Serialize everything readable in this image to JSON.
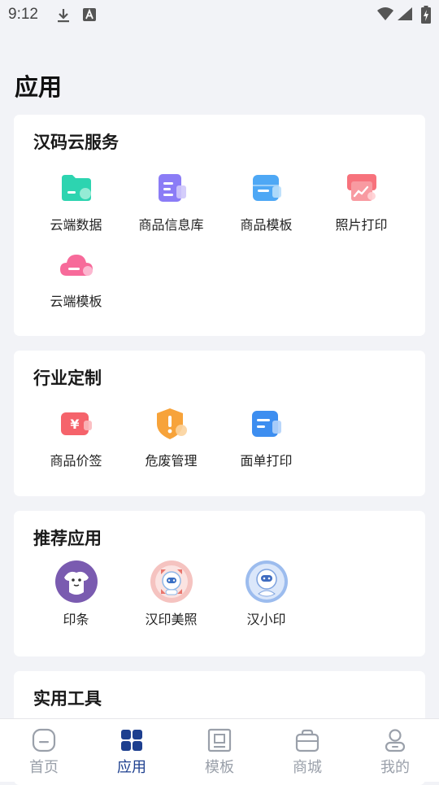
{
  "status_bar": {
    "time": "9:12"
  },
  "page_title": "应用",
  "sections": {
    "cloud": {
      "title": "汉码云服务",
      "items": [
        {
          "label": "云端数据",
          "icon": "folder-icon"
        },
        {
          "label": "商品信息库",
          "icon": "document-icon"
        },
        {
          "label": "商品模板",
          "icon": "template-icon"
        },
        {
          "label": "照片打印",
          "icon": "photo-print-icon"
        },
        {
          "label": "云端模板",
          "icon": "cloud-icon"
        }
      ]
    },
    "industry": {
      "title": "行业定制",
      "items": [
        {
          "label": "商品价签",
          "icon": "price-tag-icon"
        },
        {
          "label": "危废管理",
          "icon": "hazard-shield-icon"
        },
        {
          "label": "面单打印",
          "icon": "waybill-icon"
        }
      ]
    },
    "recommended": {
      "title": "推荐应用",
      "items": [
        {
          "label": "印条",
          "icon": "yintiao-app-icon"
        },
        {
          "label": "汉印美照",
          "icon": "hanyin-meizhao-app-icon"
        },
        {
          "label": "汉小印",
          "icon": "hanxiaoyin-app-icon"
        }
      ]
    },
    "tools": {
      "title": "实用工具"
    }
  },
  "tab_bar": {
    "active": "应用",
    "items": [
      {
        "label": "首页",
        "icon": "home-icon"
      },
      {
        "label": "应用",
        "icon": "apps-grid-icon"
      },
      {
        "label": "模板",
        "icon": "template-frame-icon"
      },
      {
        "label": "商城",
        "icon": "shop-bag-icon"
      },
      {
        "label": "我的",
        "icon": "profile-icon"
      }
    ]
  },
  "colors": {
    "background": "#f2f3f7",
    "accent_active": "#1d3f8f",
    "tab_inactive": "#9aa0aa",
    "card": "#ffffff"
  }
}
